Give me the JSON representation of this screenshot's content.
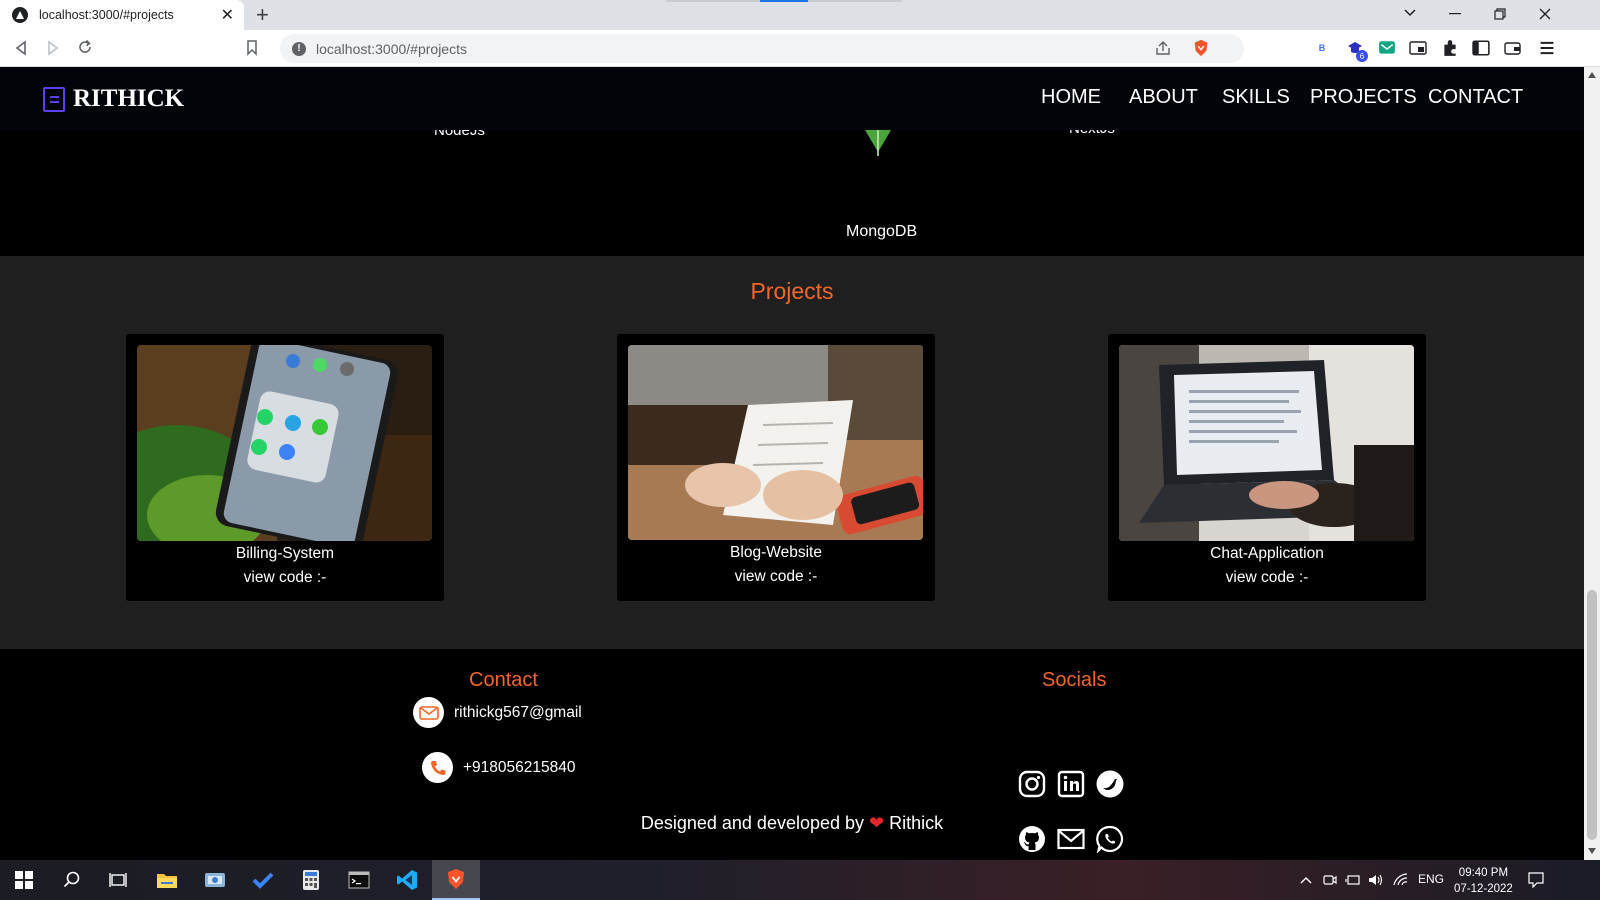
{
  "browser": {
    "tab_title": "localhost:3000/#projects",
    "tab_close": "✕",
    "new_tab": "+",
    "url": "localhost:3000/#projects",
    "ext_badge": "6"
  },
  "site": {
    "logo_text": "RITHICK",
    "nav": {
      "home": "HOME",
      "about": "ABOUT",
      "skills": "SKILLS",
      "projects": "PROJECTS",
      "contact": "CONTACT"
    },
    "skills_partial": {
      "left": "NodeJs",
      "center": "MongoDB",
      "right": "NextJs"
    },
    "projects": {
      "title": "Projects",
      "items": [
        {
          "title": "Billing-System",
          "link": "view code :-"
        },
        {
          "title": "Blog-Website",
          "link": "view code :-"
        },
        {
          "title": "Chat-Application",
          "link": "view code :-"
        }
      ]
    },
    "footer": {
      "contact_heading": "Contact",
      "email": "rithickg567@gmail",
      "phone": "+918056215840",
      "socials_heading": "Socials",
      "credit_prefix": "Designed and developed by",
      "credit_heart": "❤",
      "credit_name": "Rithick"
    }
  },
  "taskbar": {
    "lang": "ENG",
    "time": "09:40 PM",
    "date": "07-12-2022"
  },
  "colors": {
    "accent": "#f2662a",
    "logo": "#5b3ff0",
    "heart": "#e3262b"
  }
}
